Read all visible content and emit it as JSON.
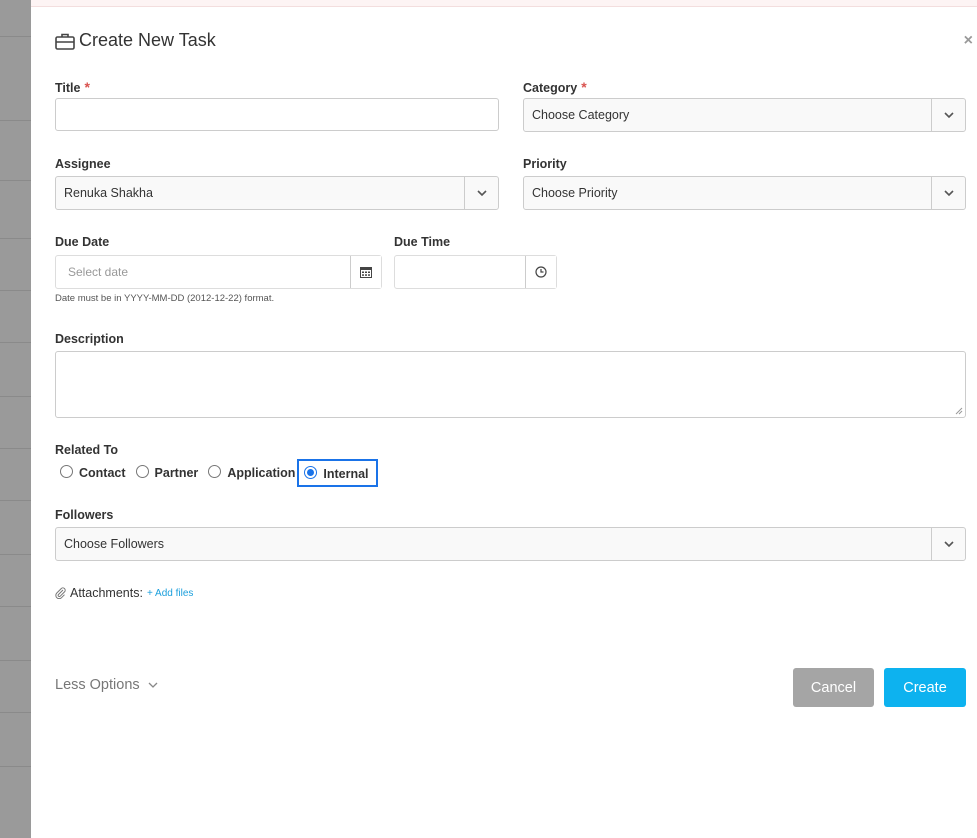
{
  "modal": {
    "title": "Create New Task",
    "close_glyph": "×"
  },
  "fields": {
    "title": {
      "label": "Title",
      "required_mark": "*",
      "value": ""
    },
    "category": {
      "label": "Category",
      "required_mark": "*",
      "value": "Choose Category"
    },
    "assignee": {
      "label": "Assignee",
      "value": "Renuka Shakha"
    },
    "priority": {
      "label": "Priority",
      "value": "Choose Priority"
    },
    "due_date": {
      "label": "Due Date",
      "placeholder": "Select date",
      "hint": "Date must be in YYYY-MM-DD (2012-12-22) format."
    },
    "due_time": {
      "label": "Due Time",
      "value": ""
    },
    "description": {
      "label": "Description",
      "value": ""
    },
    "related_to": {
      "label": "Related To",
      "options": [
        "Contact",
        "Partner",
        "Application",
        "Internal"
      ],
      "selected": "Internal"
    },
    "followers": {
      "label": "Followers",
      "value": "Choose Followers"
    },
    "attachments": {
      "label": "Attachments:",
      "add_link": "+ Add files"
    }
  },
  "footer": {
    "less_options": "Less Options",
    "cancel_label": "Cancel",
    "create_label": "Create"
  },
  "colors": {
    "primary": "#0db2ef",
    "cancel": "#a5a5a5",
    "required": "#d9534f",
    "focus": "#1a73e8",
    "link": "#1a9fdc"
  }
}
